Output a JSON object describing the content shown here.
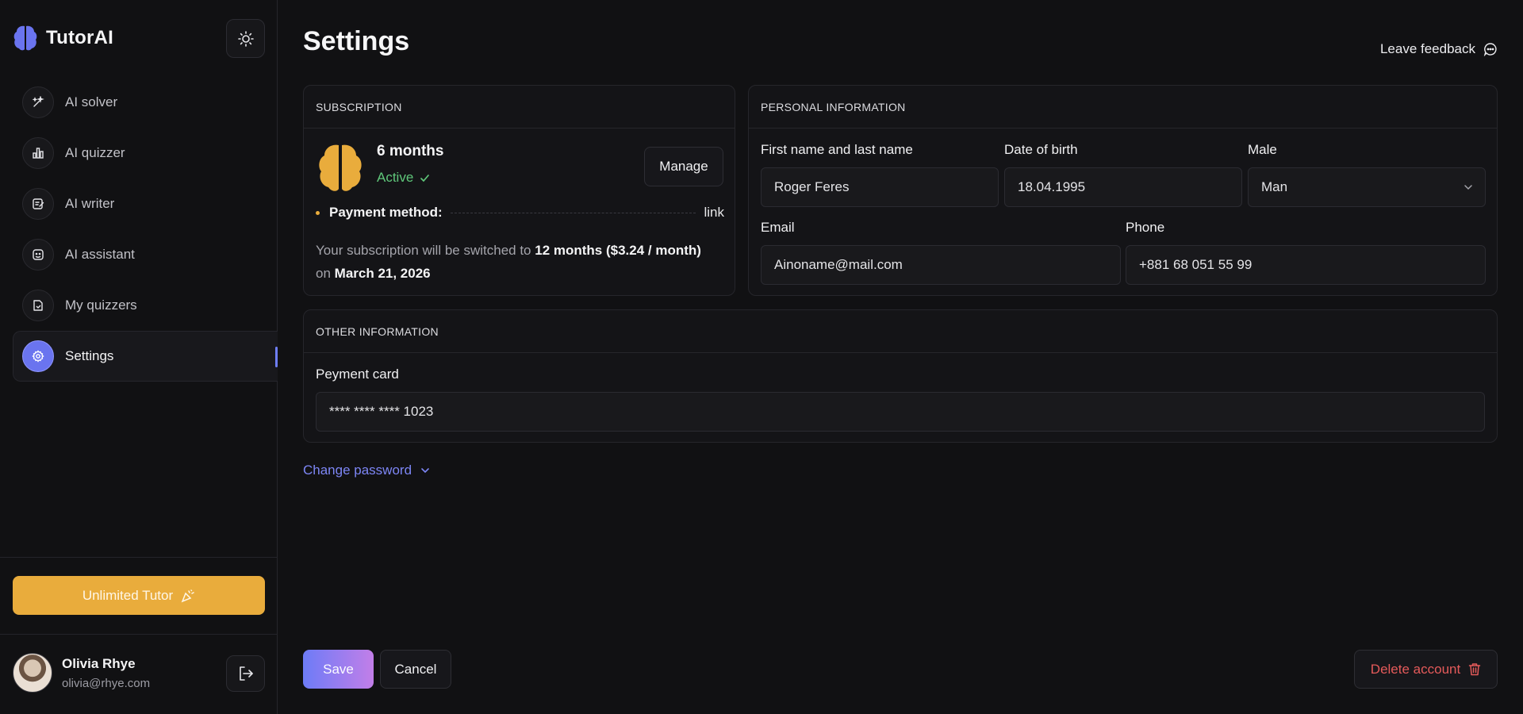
{
  "brand": {
    "name": "TutorAI"
  },
  "theme_toggle": {
    "icon": "sun-icon"
  },
  "sidebar": {
    "items": [
      {
        "label": "AI solver",
        "icon": "magic-wand-icon",
        "active": false
      },
      {
        "label": "AI quizzer",
        "icon": "bar-chart-icon",
        "active": false
      },
      {
        "label": "AI writer",
        "icon": "edit-note-icon",
        "active": false
      },
      {
        "label": "AI assistant",
        "icon": "robot-face-icon",
        "active": false
      },
      {
        "label": "My quizzers",
        "icon": "document-icon",
        "active": false
      },
      {
        "label": "Settings",
        "icon": "gear-icon",
        "active": true
      }
    ],
    "upgrade_label": "Unlimited Tutor",
    "user": {
      "name": "Olivia Rhye",
      "email": "olivia@rhye.com"
    }
  },
  "header": {
    "title": "Settings",
    "feedback_label": "Leave feedback"
  },
  "subscription": {
    "heading": "SUBSCRIPTION",
    "plan": "6 months",
    "status": "Active",
    "manage_label": "Manage",
    "payment_method_label": "Payment method:",
    "payment_method_value": "link",
    "note_prefix": "Your subscription will be switched to",
    "note_plan": "12 months ($3.24 / month)",
    "note_on": "on",
    "note_date": "March 21, 2026"
  },
  "personal": {
    "heading": "PERSONAL INFORMATION",
    "name_label": "First name and last name",
    "name_value": "Roger Feres",
    "dob_label": "Date of birth",
    "dob_value": "18.04.1995",
    "gender_label": "Male",
    "gender_value": "Man",
    "email_label": "Email",
    "email_value": "Ainoname@mail.com",
    "phone_label": "Phone",
    "phone_value": "+881 68 051 55 99"
  },
  "other": {
    "heading": "OTHER INFORMATION",
    "card_label": "Peyment card",
    "card_value": "**** **** **** 1023"
  },
  "change_password_label": "Change password",
  "actions": {
    "save": "Save",
    "cancel": "Cancel",
    "delete": "Delete account"
  },
  "colors": {
    "accent": "#6a74ef",
    "brand_logo": "#6a74ef",
    "plan_logo": "#e9ac3c",
    "upgrade": "#e9ac3c",
    "active_status": "#5fc77a",
    "danger": "#e45a5a",
    "background": "#111113"
  }
}
